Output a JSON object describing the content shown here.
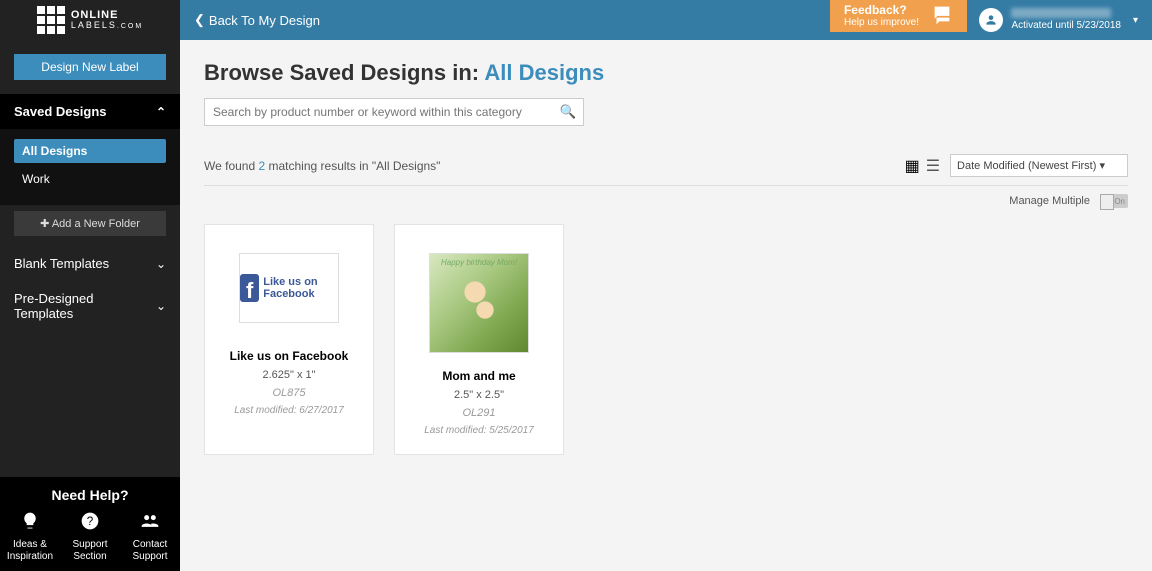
{
  "topbar": {
    "back_label": "Back To My Design",
    "feedback_title": "Feedback?",
    "feedback_sub": "Help us improve!",
    "account_status": "Activated until 5/23/2018"
  },
  "sidebar": {
    "design_btn": "Design New Label",
    "saved_designs_hdr": "Saved Designs",
    "folders": [
      {
        "label": "All Designs",
        "active": true
      },
      {
        "label": "Work",
        "active": false
      }
    ],
    "add_folder": "Add a New Folder",
    "blank_templates": "Blank Templates",
    "predesigned_templates": "Pre-Designed Templates"
  },
  "main": {
    "title_prefix": "Browse Saved Designs in: ",
    "title_category": "All Designs",
    "search_placeholder": "Search by product number or keyword within this category",
    "results_prefix": "We found ",
    "results_count": "2",
    "results_suffix": " matching results in \"All Designs\"",
    "sort_selected": "Date Modified (Newest First)",
    "manage_label": "Manage Multiple",
    "toggle_state": "On"
  },
  "cards": [
    {
      "title": "Like us on Facebook",
      "dim": "2.625\" x 1\"",
      "sku": "OL875",
      "modified": "Last modified: 6/27/2017",
      "thumb_text": "Like us on Facebook"
    },
    {
      "title": "Mom and me",
      "dim": "2.5\" x 2.5\"",
      "sku": "OL291",
      "modified": "Last modified: 5/25/2017",
      "thumb_caption": "Happy birthday Mom!"
    }
  ],
  "help": {
    "title": "Need Help?",
    "items": [
      {
        "label": "Ideas & Inspiration"
      },
      {
        "label": "Support Section"
      },
      {
        "label": "Contact Support"
      }
    ]
  }
}
